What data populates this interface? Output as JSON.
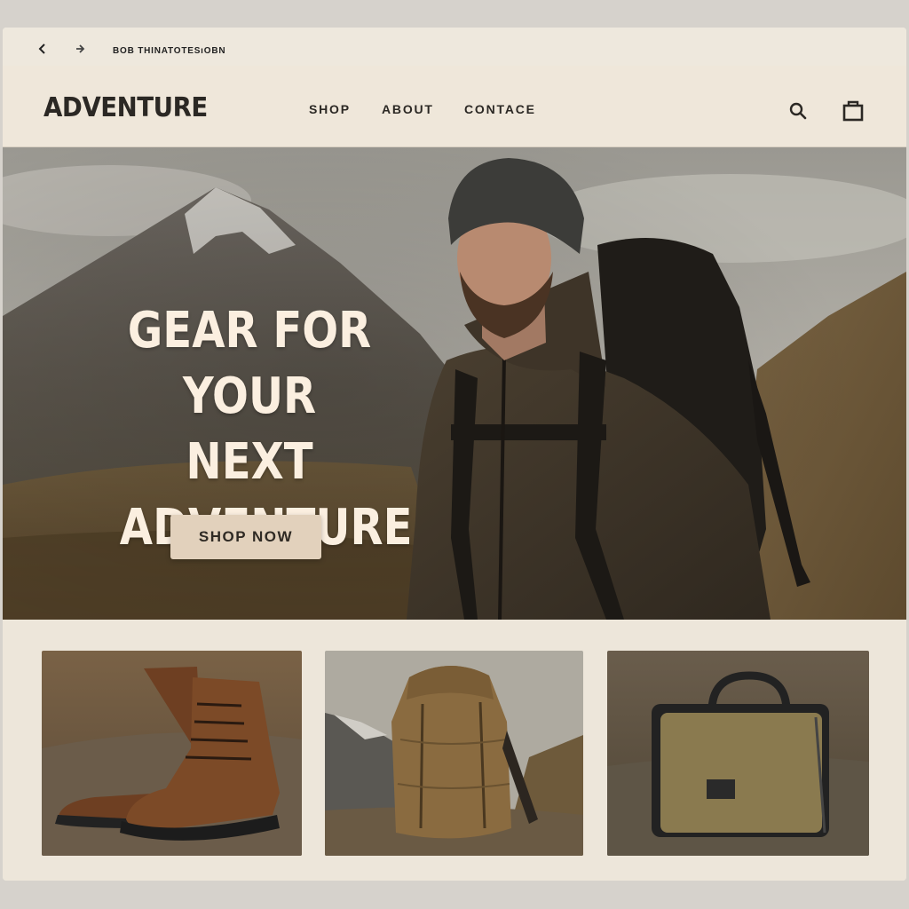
{
  "browser": {
    "address": "BOB THINATOTESıOBN",
    "back_icon": "chevron-left-icon",
    "forward_icon": "arrow-right-icon"
  },
  "header": {
    "logo": "ADVENTURE",
    "nav": [
      "SHOP",
      "ABOUT",
      "CONTACE"
    ],
    "search_icon": "search-icon",
    "cart_icon": "shopping-bag-icon"
  },
  "hero": {
    "title_lines": [
      "GEAR FOR",
      "YOUR NEXT",
      "ADVENTURE"
    ],
    "cta_label": "SHOP NOW"
  },
  "products": [
    {
      "image": "hiking-boots"
    },
    {
      "image": "backpack"
    },
    {
      "image": "duffel-bag"
    }
  ],
  "colors": {
    "page_bg": "#ede6da",
    "text_dark": "#2b2824",
    "hero_title": "#fbefe0",
    "button_bg": "#e2d1bc"
  }
}
